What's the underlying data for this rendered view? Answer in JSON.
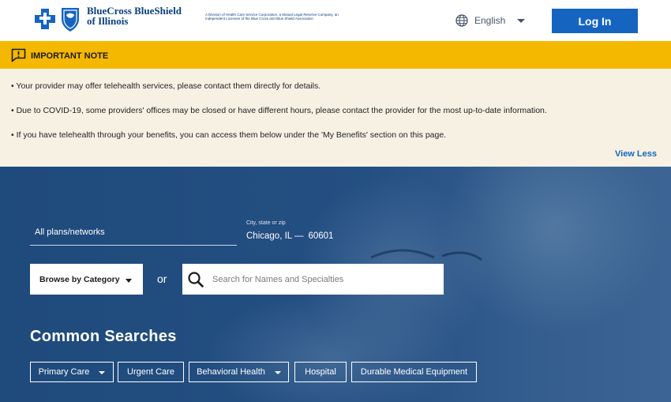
{
  "header": {
    "logo": {
      "line1": "BlueCross BlueShield",
      "line2": "of Illinois",
      "tagline": "A Division of Health Care Service Corporation, a Mutual Legal Reserve Company, an Independent Licensee of the Blue Cross and Blue Shield Association"
    },
    "language": {
      "icon": "globe-icon",
      "label": "English"
    },
    "login_label": "Log In"
  },
  "notice": {
    "icon": "message-alert-icon",
    "title": "IMPORTANT NOTE",
    "bullets": [
      "• Your provider may offer telehealth services, please contact them directly for details.",
      "• Due to COVID-19, some providers' offices may be closed or have different hours, please contact the provider for the most up-to-date information.",
      "• If you have telehealth through your benefits, you can access them below under the 'My Benefits' section on this page."
    ],
    "view_less": "View Less"
  },
  "search": {
    "plans_label": "All plans/networks",
    "location_label": "City, state or zip",
    "location_city": "Chicago, IL —",
    "location_zip": "60601",
    "browse_label": "Browse by Category",
    "or_label": "or",
    "search_icon": "search-icon",
    "search_placeholder": "Search for Names and Specialties"
  },
  "common_searches": {
    "title": "Common Searches",
    "chips": [
      {
        "label": "Primary Care"
      },
      {
        "label": "Urgent Care"
      },
      {
        "label": "Behavioral Health"
      },
      {
        "label": "Hospital"
      },
      {
        "label": "Durable Medical Equipment"
      }
    ]
  },
  "colors": {
    "brand_blue": "#1565c0",
    "notice_yellow": "#f5b800",
    "notice_body": "#f6f1e3",
    "hero_blue": "#244f82"
  }
}
